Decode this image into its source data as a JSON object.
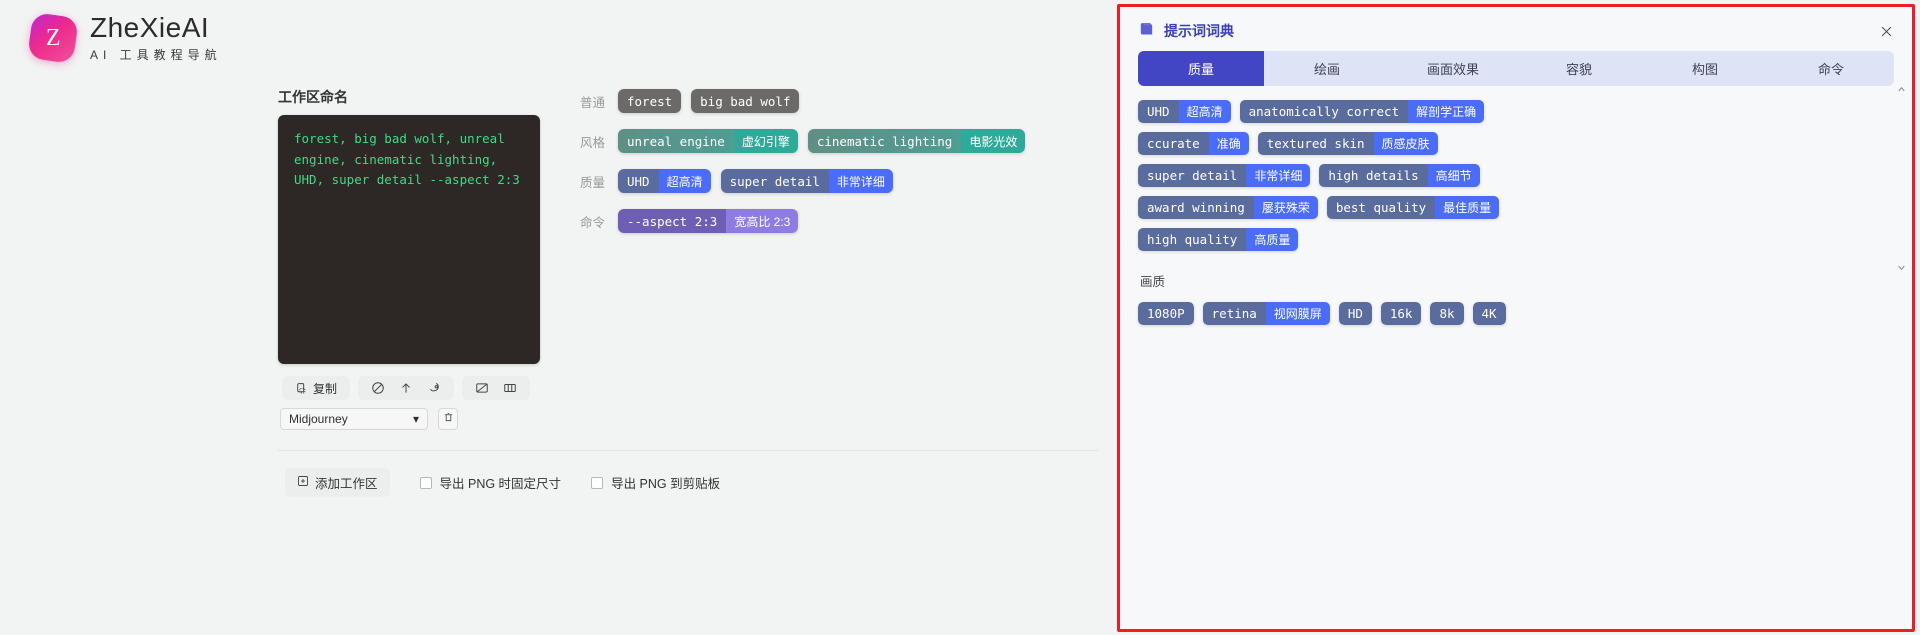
{
  "brand": {
    "badge_letter": "Z",
    "title": "ZheXieAI",
    "subtitle": "AI 工具教程导航"
  },
  "workspace": {
    "label": "工作区命名",
    "prompt_text": "forest, big bad wolf, unreal engine, cinematic lighting, UHD, super detail --aspect 2:3",
    "toolbar": {
      "copy_label": "复制",
      "icons": [
        "clipboard-icon",
        "ban-icon",
        "arrow-up-icon",
        "brush-icon",
        "image-icon",
        "image-frame-icon"
      ]
    },
    "model_select": {
      "value": "Midjourney",
      "caret": "▾"
    },
    "delete_icon": "trash-icon"
  },
  "tag_rows": [
    {
      "label": "普通",
      "style": "grey",
      "tags": [
        {
          "en": "forest",
          "cn": ""
        },
        {
          "en": "big bad wolf",
          "cn": ""
        }
      ]
    },
    {
      "label": "风格",
      "style": "teal",
      "tags": [
        {
          "en": "unreal engine",
          "cn": "虚幻引擎"
        },
        {
          "en": "cinematic lighting",
          "cn": "电影光效"
        }
      ]
    },
    {
      "label": "质量",
      "style": "blue",
      "tags": [
        {
          "en": "UHD",
          "cn": "超高清"
        },
        {
          "en": "super detail",
          "cn": "非常详细"
        }
      ]
    },
    {
      "label": "命令",
      "style": "purple",
      "tags": [
        {
          "en": "--aspect 2:3",
          "cn": "宽高比 2:3"
        }
      ]
    }
  ],
  "bottom_bar": {
    "add_workspace": "添加工作区",
    "add_icon": "plus-square-icon",
    "checkbox_fixed_size": "导出 PNG 时固定尺寸",
    "checkbox_clipboard": "导出 PNG 到剪贴板"
  },
  "panel": {
    "title": "提示词词典",
    "title_icon": "book-icon",
    "close_icon": "close-icon",
    "scroll_up_icon": "chevron-up-icon",
    "scroll_down_icon": "chevron-down-icon",
    "tabs": [
      {
        "label": "质量",
        "active": true
      },
      {
        "label": "绘画",
        "active": false
      },
      {
        "label": "画面效果",
        "active": false
      },
      {
        "label": "容貌",
        "active": false
      },
      {
        "label": "构图",
        "active": false
      },
      {
        "label": "命令",
        "active": false
      }
    ],
    "chip_lines": [
      [
        {
          "en": "UHD",
          "cn": "超高清"
        },
        {
          "en": "anatomically correct",
          "cn": "解剖学正确"
        }
      ],
      [
        {
          "en": "ccurate",
          "cn": "准确"
        },
        {
          "en": "textured skin",
          "cn": "质感皮肤"
        }
      ],
      [
        {
          "en": "super detail",
          "cn": "非常详细"
        },
        {
          "en": "high details",
          "cn": "高细节"
        }
      ],
      [
        {
          "en": "award winning",
          "cn": "屡获殊荣"
        },
        {
          "en": "best quality",
          "cn": "最佳质量"
        }
      ],
      [
        {
          "en": "high quality",
          "cn": "高质量"
        }
      ]
    ],
    "section_title": "画质",
    "section_chips": [
      {
        "en": "1080P",
        "cn": ""
      },
      {
        "en": "retina",
        "cn": "视网膜屏"
      },
      {
        "en": "HD",
        "cn": ""
      },
      {
        "en": "16k",
        "cn": ""
      },
      {
        "en": "8k",
        "cn": ""
      },
      {
        "en": "4K",
        "cn": ""
      }
    ]
  },
  "colors": {
    "accent_indigo": "#4246c4",
    "tag_blue": "#4a6cf7",
    "tag_teal": "#2fa99a",
    "tag_purple": "#8f7ce0",
    "panel_border_red": "#ee1c24",
    "terminal_green": "#3ddc84"
  }
}
